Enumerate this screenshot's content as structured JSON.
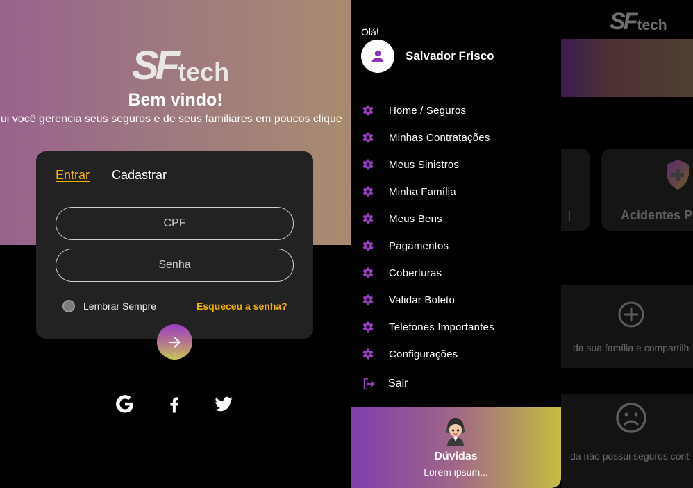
{
  "login": {
    "logo": {
      "sf": "SF",
      "tech": "tech"
    },
    "welcome": "Bem vindo!",
    "subtitle": "qui você gerencia seus seguros e de seus familiares em poucos clique",
    "tabs": {
      "login": "Entrar",
      "register": "Cadastrar"
    },
    "cpf_placeholder": "CPF",
    "password_placeholder": "Senha",
    "remember_label": "Lembrar Sempre",
    "forgot_label": "Esqueceu a senha?",
    "social": [
      "google-icon",
      "facebook-icon",
      "twitter-icon"
    ],
    "colors": {
      "accent": "#f5b400",
      "card": "#222222"
    }
  },
  "drawer": {
    "greeting": "Olá!",
    "user_name": "Salvador Frisco",
    "menu_icon": "gear-icon",
    "items": [
      {
        "label": "Home / Seguros"
      },
      {
        "label": "Minhas Contratações"
      },
      {
        "label": "Meus Sinistros"
      },
      {
        "label": "Minha Família"
      },
      {
        "label": "Meus Bens"
      },
      {
        "label": "Pagamentos"
      },
      {
        "label": "Coberturas"
      },
      {
        "label": "Validar Boleto"
      },
      {
        "label": "Telefones Importantes"
      },
      {
        "label": "Configurações"
      }
    ],
    "logout": "Sair",
    "help": {
      "title": "Dúvidas",
      "text": "Lorem ipsum..."
    },
    "colors": {
      "icon": "#9b3fc6"
    }
  },
  "home": {
    "logo": {
      "sf": "SF",
      "tech": "tech"
    },
    "card_label": "Acidentes Pe",
    "family_text": "da sua família e compartilh",
    "no_insurance_text": "da não possui seguros cont"
  }
}
